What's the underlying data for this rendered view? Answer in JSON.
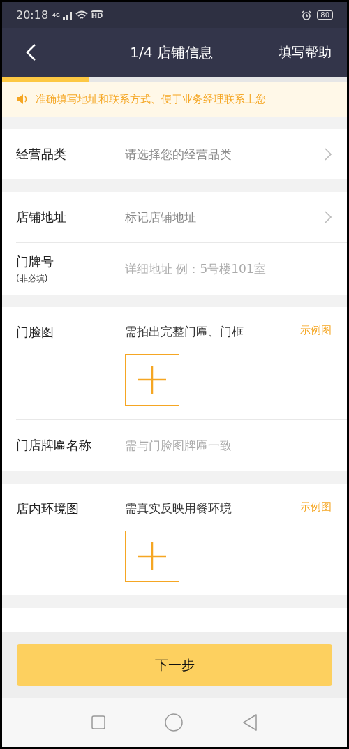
{
  "status_bar": {
    "time": "20:18",
    "network": "4G",
    "hd": "HD",
    "battery": "80"
  },
  "nav": {
    "title": "1/4 店铺信息",
    "help": "填写帮助"
  },
  "progress": {
    "level": 0.25
  },
  "notice": {
    "text": "准确填写地址和联系方式、便于业务经理联系上您"
  },
  "sections": [
    {
      "rows": [
        {
          "kind": "select",
          "label": "经营品类",
          "placeholder": "请选择您的经营品类"
        }
      ]
    },
    {
      "rows": [
        {
          "kind": "select",
          "label": "店铺地址",
          "placeholder": "标记店铺地址"
        },
        {
          "kind": "input",
          "label": "门牌号",
          "note": "(非必填)",
          "placeholder": "详细地址 例：5号楼101室"
        }
      ]
    },
    {
      "rows": [
        {
          "kind": "photo",
          "label": "门脸图",
          "hint": "需拍出完整门匾、门框",
          "link": "示例图"
        },
        {
          "kind": "input",
          "label": "门店牌匾名称",
          "placeholder": "需与门脸图牌匾一致"
        }
      ]
    },
    {
      "rows": [
        {
          "kind": "photo",
          "label": "店内环境图",
          "hint": "需真实反映用餐环境",
          "link": "示例图"
        }
      ]
    }
  ],
  "next_button": "下一步"
}
